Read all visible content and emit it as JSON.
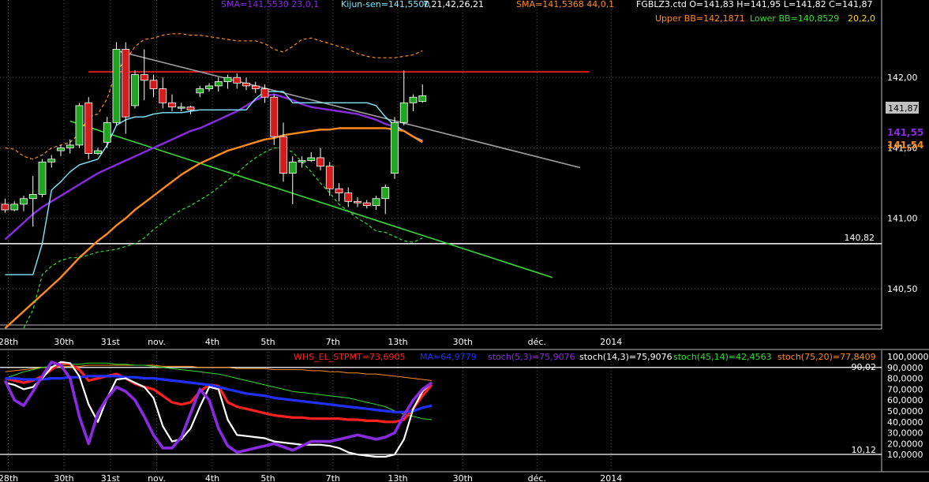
{
  "main_panel": {
    "header": [
      {
        "text": "SMA=141,5530  23,0,1",
        "color": "#8a2be2"
      },
      {
        "text": "Kijun-sen=141,5500",
        "color": "#7fe9ff"
      },
      {
        "text": "7,21,42,26,21",
        "color": "#ffffff"
      },
      {
        "text": "SMA=141,5368  44,0,1",
        "color": "#ff8c1a"
      },
      {
        "text": "FGBLZ3.ctd O=141,83 H=141,95 L=141,82 C=141,87",
        "color": "#ffffff"
      }
    ],
    "header2": [
      {
        "text": "Upper BB=142,1871",
        "color": "#ff8c1a"
      },
      {
        "text": "Lower BB=140,8529",
        "color": "#33dd33"
      },
      {
        "text": "20,2,0",
        "color": "#ffd700"
      }
    ],
    "y_ticks": [
      "142,00",
      "141,50",
      "141,00",
      "140,50"
    ],
    "price_labels": [
      {
        "text": "141,87",
        "color": "#000000",
        "bg": "#c0c0c0"
      },
      {
        "text": "141,55",
        "color": "#8a2be2"
      },
      {
        "text": "141,54",
        "color": "#ff8c1a"
      }
    ],
    "level_label": "140,82"
  },
  "x_ticks": [
    "28th",
    "30th",
    "31st",
    "nov.",
    "4th",
    "5th",
    "7th",
    "13th",
    "30th",
    "déc.",
    "2014"
  ],
  "osc_panel": {
    "header": [
      {
        "text": "WHS_EL_STPMT=73,6905",
        "color": "#ff2020"
      },
      {
        "text": "MA=64,9779",
        "color": "#2030ff"
      },
      {
        "text": "stoch(5,3)=75,9076",
        "color": "#8a2be2"
      },
      {
        "text": "stoch(14,3)=75,9076",
        "color": "#ffffff"
      },
      {
        "text": "stoch(45,14)=42,4563",
        "color": "#33dd33"
      },
      {
        "text": "stoch(75,20)=77,8409",
        "color": "#ff8c1a"
      }
    ],
    "y_ticks": [
      "100,0000",
      "90,0000",
      "80,0000",
      "70,0000",
      "60,0000",
      "50,0000",
      "40,0000",
      "30,0000",
      "20,0000",
      "10,0000"
    ],
    "upper_label": "90,02",
    "lower_label": "10,12"
  },
  "chart_data": [
    {
      "type": "candlestick",
      "title": "FGBLZ3.ctd",
      "ylim": [
        140.22,
        142.55
      ],
      "y_ticks": [
        142.0,
        141.5,
        141.0,
        140.5
      ],
      "candles": [
        {
          "o": 141.1,
          "h": 141.14,
          "l": 141.04,
          "c": 141.06
        },
        {
          "o": 141.06,
          "h": 141.12,
          "l": 141.05,
          "c": 141.1
        },
        {
          "o": 141.1,
          "h": 141.16,
          "l": 141.05,
          "c": 141.14
        },
        {
          "o": 141.14,
          "h": 141.3,
          "l": 140.94,
          "c": 141.17
        },
        {
          "o": 141.17,
          "h": 141.42,
          "l": 141.15,
          "c": 141.4
        },
        {
          "o": 141.4,
          "h": 141.45,
          "l": 141.36,
          "c": 141.42
        },
        {
          "o": 141.48,
          "h": 141.52,
          "l": 141.44,
          "c": 141.5
        },
        {
          "o": 141.5,
          "h": 141.56,
          "l": 141.46,
          "c": 141.52
        },
        {
          "o": 141.52,
          "h": 141.82,
          "l": 141.5,
          "c": 141.8
        },
        {
          "o": 141.82,
          "h": 141.86,
          "l": 141.42,
          "c": 141.46
        },
        {
          "o": 141.46,
          "h": 141.5,
          "l": 141.45,
          "c": 141.48
        },
        {
          "o": 141.54,
          "h": 141.72,
          "l": 141.5,
          "c": 141.68
        },
        {
          "o": 141.68,
          "h": 142.25,
          "l": 141.66,
          "c": 142.2
        },
        {
          "o": 142.2,
          "h": 142.25,
          "l": 141.6,
          "c": 141.72
        },
        {
          "o": 141.8,
          "h": 142.05,
          "l": 141.78,
          "c": 142.02
        },
        {
          "o": 142.02,
          "h": 142.2,
          "l": 141.84,
          "c": 141.98
        },
        {
          "o": 141.98,
          "h": 142.02,
          "l": 141.86,
          "c": 141.92
        },
        {
          "o": 141.92,
          "h": 142.0,
          "l": 141.78,
          "c": 141.82
        },
        {
          "o": 141.82,
          "h": 141.88,
          "l": 141.76,
          "c": 141.79
        },
        {
          "o": 141.79,
          "h": 141.82,
          "l": 141.76,
          "c": 141.79
        },
        {
          "o": 141.79,
          "h": 141.8,
          "l": 141.74,
          "c": 141.77
        },
        {
          "o": 141.89,
          "h": 141.94,
          "l": 141.86,
          "c": 141.92
        },
        {
          "o": 141.92,
          "h": 141.96,
          "l": 141.9,
          "c": 141.94
        },
        {
          "o": 141.94,
          "h": 142.0,
          "l": 141.9,
          "c": 141.97
        },
        {
          "o": 141.97,
          "h": 142.02,
          "l": 141.92,
          "c": 142.0
        },
        {
          "o": 142.0,
          "h": 142.03,
          "l": 141.92,
          "c": 141.96
        },
        {
          "o": 141.96,
          "h": 142.0,
          "l": 141.91,
          "c": 141.94
        },
        {
          "o": 141.94,
          "h": 141.97,
          "l": 141.89,
          "c": 141.92
        },
        {
          "o": 141.92,
          "h": 141.95,
          "l": 141.82,
          "c": 141.86
        },
        {
          "o": 141.86,
          "h": 141.88,
          "l": 141.52,
          "c": 141.58
        },
        {
          "o": 141.58,
          "h": 141.68,
          "l": 141.26,
          "c": 141.32
        },
        {
          "o": 141.32,
          "h": 141.44,
          "l": 141.1,
          "c": 141.4
        },
        {
          "o": 141.4,
          "h": 141.44,
          "l": 141.36,
          "c": 141.41
        },
        {
          "o": 141.41,
          "h": 141.47,
          "l": 141.4,
          "c": 141.43
        },
        {
          "o": 141.43,
          "h": 141.5,
          "l": 141.34,
          "c": 141.37
        },
        {
          "o": 141.37,
          "h": 141.4,
          "l": 141.16,
          "c": 141.21
        },
        {
          "o": 141.21,
          "h": 141.25,
          "l": 141.12,
          "c": 141.18
        },
        {
          "o": 141.18,
          "h": 141.22,
          "l": 141.08,
          "c": 141.12
        },
        {
          "o": 141.12,
          "h": 141.15,
          "l": 141.08,
          "c": 141.11
        },
        {
          "o": 141.11,
          "h": 141.13,
          "l": 141.07,
          "c": 141.09
        },
        {
          "o": 141.09,
          "h": 141.16,
          "l": 141.06,
          "c": 141.14
        },
        {
          "o": 141.14,
          "h": 141.24,
          "l": 141.03,
          "c": 141.22
        },
        {
          "o": 141.32,
          "h": 141.72,
          "l": 141.28,
          "c": 141.68
        },
        {
          "o": 141.68,
          "h": 142.05,
          "l": 141.66,
          "c": 141.82
        },
        {
          "o": 141.82,
          "h": 141.88,
          "l": 141.76,
          "c": 141.86
        },
        {
          "o": 141.83,
          "h": 141.95,
          "l": 141.82,
          "c": 141.87
        }
      ],
      "x_tick_index": [
        0,
        6,
        11,
        16,
        22,
        28,
        35,
        42,
        49,
        57,
        65
      ],
      "overlays": [
        {
          "name": "SMA 23",
          "color": "#8a2be2",
          "width": 2.4,
          "start": 0,
          "values": [
            140.85,
            140.91,
            140.97,
            141.03,
            141.08,
            141.12,
            141.16,
            141.2,
            141.24,
            141.28,
            141.32,
            141.35,
            141.38,
            141.41,
            141.44,
            141.47,
            141.5,
            141.53,
            141.56,
            141.59,
            141.62,
            141.64,
            141.67,
            141.7,
            141.73,
            141.76,
            141.8,
            141.84,
            141.87,
            141.88,
            141.86,
            141.84,
            141.81,
            141.79,
            141.78,
            141.77,
            141.76,
            141.75,
            141.74,
            141.72,
            141.7,
            141.67,
            141.65,
            141.62,
            141.58,
            141.55
          ]
        },
        {
          "name": "Kijun-sen",
          "color": "#7fe9ff",
          "width": 1.4,
          "start": 0,
          "values": [
            140.6,
            140.6,
            140.6,
            140.6,
            140.82,
            141.2,
            141.26,
            141.33,
            141.38,
            141.4,
            141.42,
            141.52,
            141.66,
            141.7,
            141.72,
            141.72,
            141.74,
            141.75,
            141.75,
            141.75,
            141.76,
            141.77,
            141.77,
            141.77,
            141.77,
            141.77,
            141.77,
            141.85,
            141.9,
            141.9,
            141.9,
            141.82,
            141.82,
            141.82,
            141.82,
            141.82,
            141.82,
            141.82,
            141.82,
            141.82,
            141.8,
            141.72,
            141.66,
            141.62,
            141.58,
            141.55
          ]
        },
        {
          "name": "SMA 44",
          "color": "#ff8c1a",
          "width": 2.4,
          "start": 0,
          "values": [
            140.22,
            140.28,
            140.34,
            140.4,
            140.46,
            140.52,
            140.58,
            140.65,
            140.72,
            140.78,
            140.84,
            140.89,
            140.95,
            141.0,
            141.06,
            141.11,
            141.16,
            141.21,
            141.26,
            141.31,
            141.35,
            141.39,
            141.42,
            141.45,
            141.48,
            141.5,
            141.52,
            141.54,
            141.56,
            141.57,
            141.59,
            141.6,
            141.61,
            141.62,
            141.63,
            141.63,
            141.64,
            141.64,
            141.64,
            141.64,
            141.64,
            141.64,
            141.63,
            141.62,
            141.58,
            141.54
          ]
        },
        {
          "name": "Upper BB",
          "color": "#ff8c1a",
          "width": 1.2,
          "dash": "4,3",
          "start": 0,
          "values": [
            141.5,
            141.49,
            141.44,
            141.42,
            141.45,
            141.5,
            141.52,
            141.54,
            141.6,
            141.72,
            141.74,
            141.85,
            142.05,
            142.12,
            142.22,
            142.27,
            142.28,
            142.3,
            142.31,
            142.31,
            142.3,
            142.3,
            142.29,
            142.28,
            142.27,
            142.26,
            142.26,
            142.26,
            142.24,
            142.2,
            142.18,
            142.22,
            142.27,
            142.28,
            142.26,
            142.24,
            142.22,
            142.2,
            142.17,
            142.15,
            142.14,
            142.14,
            142.14,
            142.15,
            142.16,
            142.19
          ]
        },
        {
          "name": "Lower BB",
          "color": "#33dd33",
          "width": 1.2,
          "dash": "4,3",
          "start": 2,
          "values": [
            140.22,
            140.35,
            140.6,
            140.66,
            140.7,
            140.72,
            140.72,
            140.74,
            140.76,
            140.77,
            140.78,
            140.8,
            140.82,
            140.86,
            140.92,
            140.97,
            141.02,
            141.06,
            141.09,
            141.13,
            141.17,
            141.22,
            141.27,
            141.32,
            141.38,
            141.43,
            141.47,
            141.5,
            141.5,
            141.47,
            141.4,
            141.33,
            141.25,
            141.18,
            141.1,
            141.05,
            141.0,
            140.96,
            140.91,
            140.9,
            140.87,
            140.84,
            140.83,
            140.86
          ]
        }
      ],
      "lines": [
        {
          "name": "resistance",
          "color": "#ff2020",
          "from": [
            9,
            142.04
          ],
          "to": [
            63,
            142.04
          ]
        },
        {
          "name": "support-level",
          "color": "#ffffff",
          "from": [
            0,
            140.82
          ],
          "to": [
            100,
            140.82
          ]
        },
        {
          "name": "trend-down",
          "color": "#a0a0a0",
          "from": [
            12,
            142.19
          ],
          "to": [
            62,
            141.36
          ]
        },
        {
          "name": "trend-low",
          "color": "#33dd33",
          "from": [
            7,
            141.69
          ],
          "to": [
            59,
            140.58
          ]
        }
      ]
    },
    {
      "type": "line",
      "title": "Oscillators",
      "ylim": [
        0,
        100
      ],
      "y_ticks": [
        100,
        90,
        80,
        70,
        60,
        50,
        40,
        30,
        20,
        10
      ],
      "hlines": [
        90.02,
        10.12
      ],
      "series": [
        {
          "name": "stoch(75,20)",
          "color": "#ff8c1a",
          "width": 1.0,
          "values": [
            86,
            87,
            88,
            89,
            90,
            90,
            91,
            91,
            91,
            92,
            92,
            92,
            92,
            92,
            92,
            92,
            92,
            91,
            91,
            91,
            91,
            90,
            90,
            90,
            90,
            89,
            89,
            89,
            89,
            88,
            88,
            88,
            88,
            87,
            87,
            86,
            86,
            85,
            85,
            84,
            84,
            83,
            82,
            81,
            80,
            79,
            78
          ]
        },
        {
          "name": "stoch(45,14)",
          "color": "#33dd33",
          "width": 1.0,
          "values": [
            80,
            83,
            86,
            88,
            90,
            91,
            92,
            93,
            93,
            94,
            94,
            94,
            93,
            93,
            92,
            92,
            91,
            90,
            89,
            88,
            87,
            86,
            85,
            84,
            82,
            80,
            78,
            76,
            74,
            72,
            70,
            68,
            67,
            66,
            65,
            64,
            63,
            62,
            60,
            58,
            56,
            54,
            50,
            47,
            45,
            43,
            42
          ]
        },
        {
          "name": "WHS_EL_STPMT",
          "color": "#ff2020",
          "width": 3.2,
          "values": [
            80,
            78,
            76,
            78,
            82,
            88,
            94,
            93,
            88,
            78,
            80,
            82,
            84,
            80,
            75,
            72,
            70,
            64,
            58,
            56,
            58,
            68,
            74,
            73,
            58,
            54,
            52,
            50,
            48,
            46,
            45,
            44,
            44,
            43,
            43,
            43,
            43,
            42,
            42,
            41,
            41,
            40,
            40,
            42,
            52,
            64,
            74
          ]
        },
        {
          "name": "MA",
          "color": "#2030ff",
          "width": 3.2,
          "values": [
            80,
            80,
            79,
            79,
            79,
            80,
            80,
            81,
            81,
            82,
            82,
            82,
            82,
            81,
            81,
            80,
            80,
            79,
            78,
            77,
            76,
            75,
            74,
            72,
            70,
            68,
            66,
            65,
            64,
            62,
            61,
            60,
            59,
            58,
            57,
            56,
            55,
            54,
            53,
            52,
            51,
            50,
            49,
            49,
            50,
            53,
            55
          ]
        },
        {
          "name": "stoch(14,3)",
          "color": "#ffffff",
          "width": 2.2,
          "values": [
            76,
            74,
            70,
            72,
            80,
            90,
            95,
            94,
            82,
            56,
            40,
            62,
            79,
            80,
            76,
            72,
            62,
            36,
            22,
            24,
            34,
            54,
            72,
            70,
            42,
            28,
            27,
            26,
            25,
            22,
            21,
            20,
            19,
            19,
            19,
            18,
            16,
            12,
            10,
            9,
            8,
            8,
            10,
            24,
            52,
            68,
            76
          ]
        },
        {
          "name": "stoch(5,3)",
          "color": "#8a2be2",
          "width": 3.6,
          "values": [
            78,
            60,
            55,
            68,
            82,
            95,
            92,
            80,
            45,
            20,
            48,
            62,
            72,
            68,
            60,
            45,
            28,
            16,
            16,
            26,
            48,
            70,
            60,
            34,
            18,
            12,
            14,
            16,
            18,
            20,
            17,
            14,
            18,
            22,
            22,
            22,
            24,
            26,
            28,
            26,
            24,
            26,
            30,
            46,
            60,
            70,
            76
          ]
        }
      ]
    }
  ]
}
